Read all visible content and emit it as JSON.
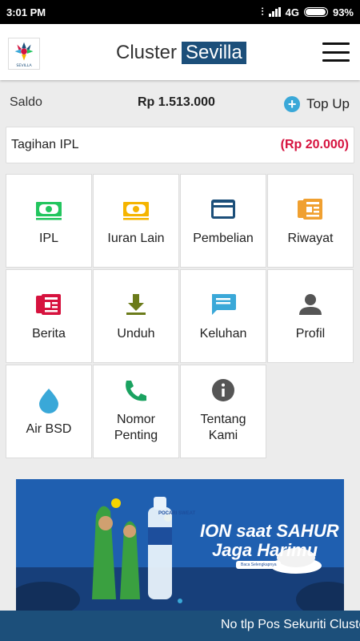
{
  "status": {
    "time": "3:01 PM",
    "network": "4G",
    "battery": "93%"
  },
  "app": {
    "title_plain": "Cluster",
    "title_highlight": "Sevilla",
    "logo_text": "SEVILLA"
  },
  "saldo": {
    "label": "Saldo",
    "value": "Rp 1.513.000",
    "topup_label": "Top Up"
  },
  "tagihan": {
    "label": "Tagihan IPL",
    "value": "(Rp 20.000)"
  },
  "menu": [
    {
      "label": "IPL",
      "icon": "money-icon",
      "color": "#22c55e"
    },
    {
      "label": "Iuran Lain",
      "icon": "money-icon",
      "color": "#f5b400"
    },
    {
      "label": "Pembelian",
      "icon": "credit-card-icon",
      "color": "#1c4f7a"
    },
    {
      "label": "Riwayat",
      "icon": "history-newspaper-icon",
      "color": "#f0a030"
    },
    {
      "label": "Berita",
      "icon": "newspaper-icon",
      "color": "#d6123e"
    },
    {
      "label": "Unduh",
      "icon": "download-icon",
      "color": "#6b7b1a"
    },
    {
      "label": "Keluhan",
      "icon": "chat-icon",
      "color": "#3aa8d8"
    },
    {
      "label": "Profil",
      "icon": "person-icon",
      "color": "#555555"
    },
    {
      "label": "Air BSD",
      "icon": "water-drop-icon",
      "color": "#3aa8d8"
    },
    {
      "label": "Nomor\nPenting",
      "icon": "phone-icon",
      "color": "#1aa260"
    },
    {
      "label": "Tentang\nKami",
      "icon": "info-icon",
      "color": "#555555"
    }
  ],
  "banner": {
    "line1": "ION saat SAHUR",
    "line2": "Jaga Harimu",
    "button": "Baca Selengkapnya",
    "bottle": "POCARI SWEAT"
  },
  "ticker": "No tlp Pos Sekuriti Cluster Sevilla"
}
